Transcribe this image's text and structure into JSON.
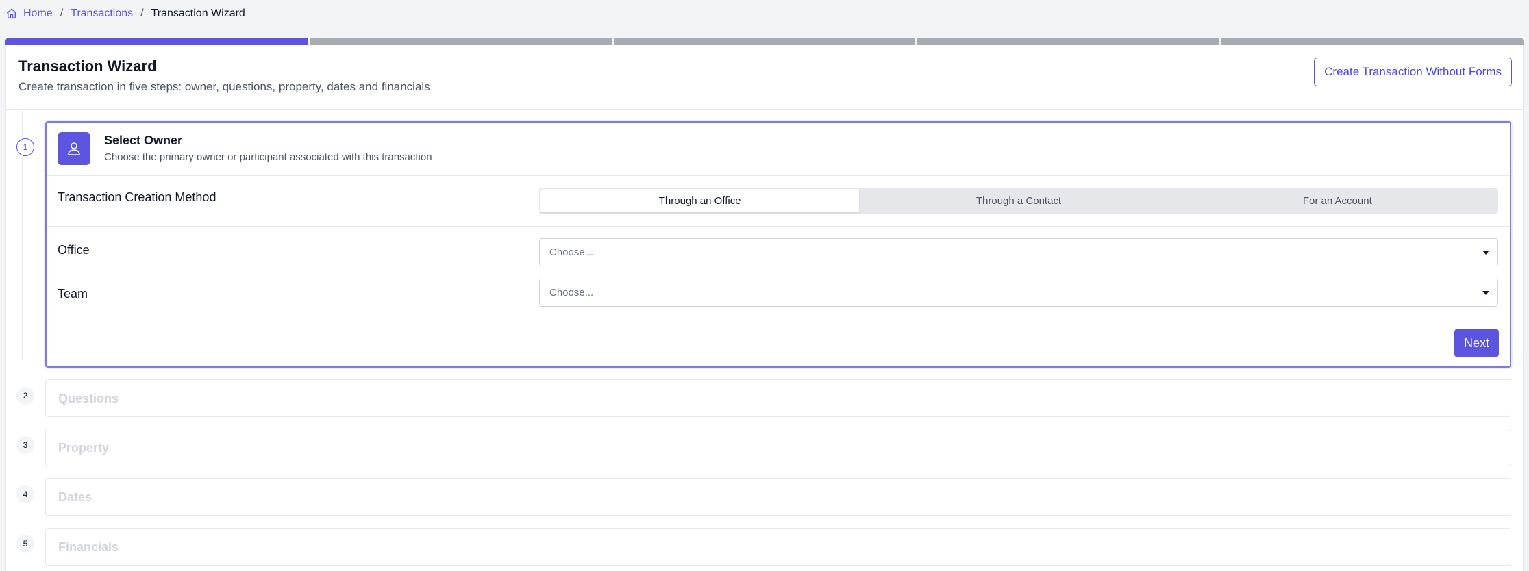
{
  "breadcrumb": {
    "home": "Home",
    "separator": "/",
    "transactions": "Transactions",
    "current": "Transaction Wizard"
  },
  "progress": {
    "total_steps": 5,
    "completed_steps": 1,
    "accent": "#5b55e0",
    "inactive": "#a7acb3"
  },
  "header": {
    "title": "Transaction Wizard",
    "subtitle": "Create transaction in five steps: owner, questions, property, dates and financials",
    "create_without_forms": "Create Transaction Without Forms"
  },
  "steps": [
    {
      "number": "1",
      "title": "Select Owner",
      "description": "Choose the primary owner or participant associated with this transaction",
      "icon": "user-icon"
    },
    {
      "number": "2",
      "title": "Questions"
    },
    {
      "number": "3",
      "title": "Property"
    },
    {
      "number": "4",
      "title": "Dates"
    },
    {
      "number": "5",
      "title": "Financials"
    }
  ],
  "owner_form": {
    "method_label": "Transaction Creation Method",
    "method_options": [
      "Through an Office",
      "Through a Contact",
      "For an Account"
    ],
    "method_selected": "Through an Office",
    "office_label": "Office",
    "office_placeholder": "Choose...",
    "team_label": "Team",
    "team_placeholder": "Choose...",
    "next_label": "Next"
  }
}
